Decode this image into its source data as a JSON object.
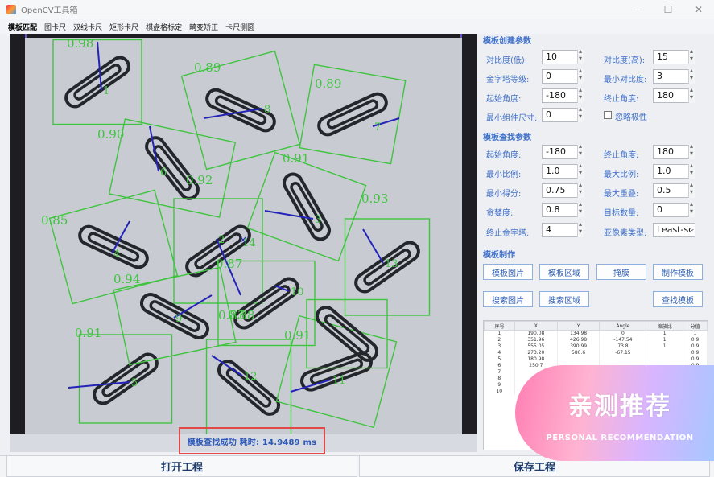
{
  "window": {
    "title": "OpenCV工具箱"
  },
  "menu": {
    "items": [
      "模板匹配",
      "图卡尺",
      "双线卡尺",
      "矩形卡尺",
      "棋盘格标定",
      "畸变矫正",
      "卡尺测圆"
    ]
  },
  "canvas": {
    "matches": [
      {
        "score": "0.98",
        "id": "1"
      },
      {
        "score": "0.89",
        "id": "8"
      },
      {
        "score": "0.89",
        "id": "7"
      },
      {
        "score": "0.90",
        "id": "6"
      },
      {
        "score": "0.92",
        "id": "2"
      },
      {
        "score": "0.91",
        "id": "3"
      },
      {
        "score": "0.93",
        "id": "13"
      },
      {
        "score": "0.85",
        "id": "4"
      },
      {
        "score": "0.91",
        "id": "5"
      },
      {
        "score": "0.94",
        "id": "9"
      },
      {
        "score": "0.87",
        "id": "10"
      },
      {
        "score": "0.83",
        "id": "12"
      },
      {
        "score": "0.91",
        "id": "11"
      },
      {
        "score": "0.88",
        "id": "14"
      }
    ]
  },
  "status": {
    "text": "模板查找成功  耗时: 14.9489 ms"
  },
  "bottom": {
    "open_project": "打开工程",
    "save_project": "保存工程"
  },
  "create_params": {
    "title": "模板创建参数",
    "contrast_low_label": "对比度(低):",
    "contrast_low": "10",
    "contrast_high_label": "对比度(高):",
    "contrast_high": "15",
    "pyramid_label": "金字塔等级:",
    "pyramid": "0",
    "min_contrast_label": "最小对比度:",
    "min_contrast": "3",
    "start_angle_label": "起始角度:",
    "start_angle": "-180",
    "end_angle_label": "终止角度:",
    "end_angle": "180",
    "min_size_label": "最小组件尺寸:",
    "min_size": "0",
    "ignore_polarity_label": "忽略极性"
  },
  "search_params": {
    "title": "模板查找参数",
    "start_angle_label": "起始角度:",
    "start_angle": "-180",
    "end_angle_label": "终止角度:",
    "end_angle": "180",
    "min_scale_label": "最小比例:",
    "min_scale": "1.0",
    "max_scale_label": "最大比例:",
    "max_scale": "1.0",
    "min_score_label": "最小得分:",
    "min_score": "0.75",
    "max_overlap_label": "最大重叠:",
    "max_overlap": "0.5",
    "greediness_label": "贪婪度:",
    "greediness": "0.8",
    "num_targets_label": "目标数量:",
    "num_targets": "0",
    "end_pyramid_label": "终止金字塔:",
    "end_pyramid": "4",
    "subpixel_label": "亚像素类型:",
    "subpixel": "Least-sc"
  },
  "template_make": {
    "title": "模板制作",
    "btn_template_image": "模板图片",
    "btn_template_region": "模板区域",
    "btn_mask": "掩膜",
    "btn_make_template": "制作模板",
    "btn_search_image": "搜索图片",
    "btn_search_region": "搜索区域",
    "btn_find_template": "查找模板"
  },
  "results": {
    "headers": [
      "序号",
      "X",
      "Y",
      "Angle",
      "缩放比",
      "分值"
    ],
    "rows": [
      [
        "1",
        "190.08",
        "134.98",
        "0",
        "1",
        "1"
      ],
      [
        "2",
        "351.96",
        "426.98",
        "-147.54",
        "1",
        "0.9"
      ],
      [
        "3",
        "555.05",
        "390.99",
        "73.8",
        "1",
        "0.9"
      ],
      [
        "4",
        "273.20",
        "580.6",
        "-67.15",
        "",
        "0.9"
      ],
      [
        "5",
        "180.98",
        "",
        "",
        "",
        "0.9"
      ],
      [
        "6",
        "250.7",
        "",
        "",
        "",
        "0.9"
      ],
      [
        "7",
        "",
        "",
        "",
        "",
        "0.9"
      ],
      [
        "8",
        "",
        "",
        "",
        "",
        "0.9"
      ],
      [
        "9",
        "",
        "",
        "",
        "",
        "0.9"
      ],
      [
        "10",
        "",
        "",
        "",
        "",
        "0.9"
      ]
    ]
  },
  "promo": {
    "title": "亲测推荐",
    "subtitle": "PERSONAL RECOMMENDATION"
  },
  "colors": {
    "match_box": "#3fc43f",
    "vector": "#2323b8",
    "status_border": "#e34848",
    "label_blue": "#3f6fc8"
  }
}
